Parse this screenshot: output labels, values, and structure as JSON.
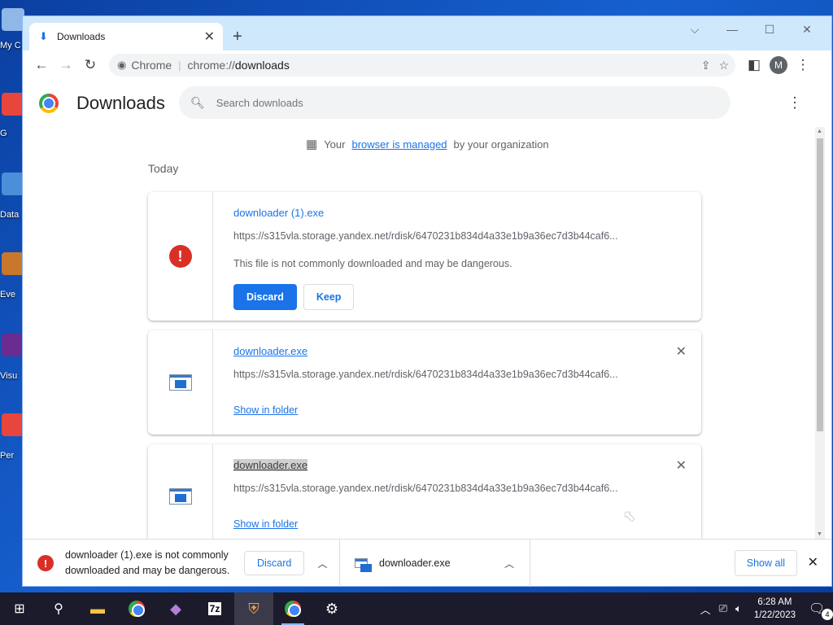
{
  "desktop": {
    "icons": [
      {
        "label": "My C",
        "icon": "computer-icon",
        "color": "#8fb8e8"
      },
      {
        "label": "G\nCl",
        "icon": "chrome-shortcut-icon",
        "color": "#e8453c"
      },
      {
        "label": "Data",
        "icon": "data-shortcut-icon",
        "color": "#4a8fd8"
      },
      {
        "label": "Eve",
        "icon": "event-shortcut-icon",
        "color": "#c9772b"
      },
      {
        "label": "Visu",
        "icon": "visual-studio-icon",
        "color": "#6a2c91"
      },
      {
        "label": "Per\nCh",
        "icon": "chrome-shortcut-icon",
        "color": "#e8453c"
      }
    ]
  },
  "browser": {
    "tab": {
      "title": "Downloads",
      "close": "✕"
    },
    "new_tab": "+",
    "controls": {
      "dropdown": "⌵",
      "minimize": "—",
      "maximize": "☐",
      "close": "✕"
    },
    "omnibox": {
      "site": "Chrome",
      "separator": "|",
      "scheme": "chrome://",
      "path": "downloads"
    },
    "profile_initial": "M"
  },
  "downloads_page": {
    "title": "Downloads",
    "search_placeholder": "Search downloads",
    "managed_prefix": "Your",
    "managed_link": "browser is managed",
    "managed_suffix": "by your organization",
    "group_label": "Today",
    "items": [
      {
        "filename": "downloader (1).exe",
        "url": "https://s315vla.storage.yandex.net/rdisk/6470231b834d4a33e1b9a36ec7d3b44caf6...",
        "warning": "This file is not commonly downloaded and may be dangerous.",
        "discard": "Discard",
        "keep": "Keep"
      },
      {
        "filename": "downloader.exe",
        "url": "https://s315vla.storage.yandex.net/rdisk/6470231b834d4a33e1b9a36ec7d3b44caf6...",
        "action": "Show in folder",
        "remove": "✕"
      },
      {
        "filename": "downloader.exe",
        "url": "https://s315vla.storage.yandex.net/rdisk/6470231b834d4a33e1b9a36ec7d3b44caf6...",
        "action": "Show in folder",
        "remove": "✕"
      }
    ]
  },
  "shelf": {
    "item1": {
      "text": "downloader (1).exe is not commonly downloaded and may be dangerous.",
      "discard": "Discard"
    },
    "item2": {
      "filename": "downloader.exe"
    },
    "show_all": "Show all",
    "close": "✕"
  },
  "taskbar": {
    "time": "6:28 AM",
    "date": "1/22/2023",
    "notifications": "4"
  },
  "colors": {
    "accent": "#1a73e8",
    "danger": "#d93025",
    "titlebar": "#cfe8fc"
  }
}
